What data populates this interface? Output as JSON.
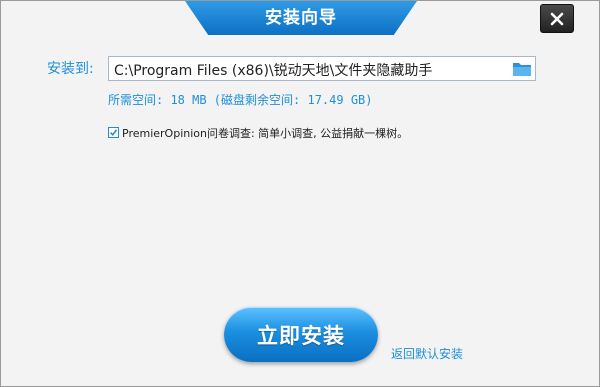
{
  "window": {
    "title": "安装向导",
    "close_icon": "close-icon"
  },
  "install": {
    "label": "安装到:",
    "path": "C:\\Program Files (x86)\\锐动天地\\文件夹隐藏助手",
    "folder_icon": "folder-icon",
    "space_info": "所需空间: 18 MB (磁盘剩余空间: 17.49 GB)"
  },
  "survey": {
    "checked": true,
    "text": "PremierOpinion问卷调查: 简单小调查, 公益捐献一棵树。"
  },
  "actions": {
    "install_button": "立即安装",
    "default_link": "返回默认安装"
  },
  "colors": {
    "accent": "#1e90d6",
    "title_bar": "#1a7fd4",
    "background": "#f3f3f3"
  }
}
